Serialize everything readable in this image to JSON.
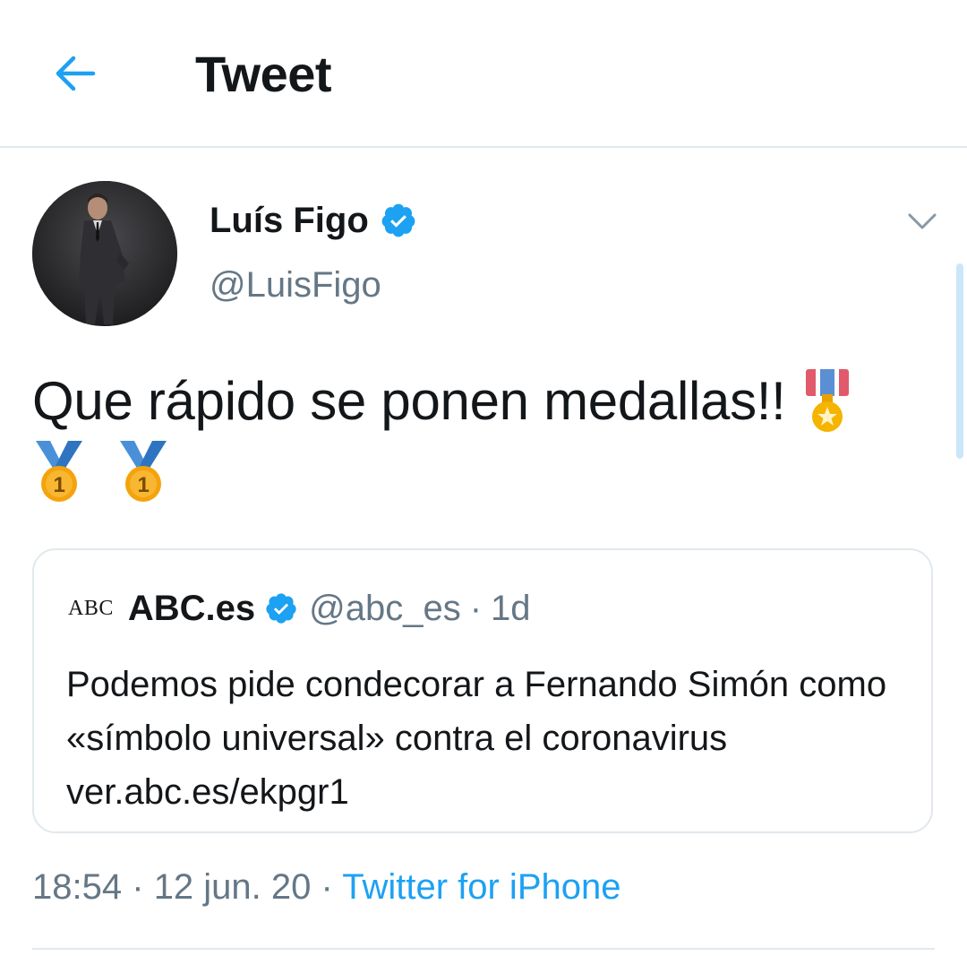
{
  "header": {
    "title": "Tweet",
    "back_icon": "arrow-left-icon",
    "accent": "#1da1f2"
  },
  "tweet": {
    "author_name": "Luís Figo",
    "author_handle": "@LuisFigo",
    "verified": true,
    "text": "Que rápido se ponen medallas!!",
    "emojis": [
      "military-medal-icon",
      "first-place-medal-icon",
      "first-place-medal-icon"
    ],
    "time": "18:54",
    "date": "12 jun. 20",
    "source": "Twitter for iPhone",
    "separator": "·"
  },
  "quote": {
    "logo_text": "ABC",
    "name": "ABC.es",
    "handle": "@abc_es",
    "separator": "·",
    "age": "1d",
    "text": "Podemos pide condecorar a Fernando Simón como «símbolo universal» contra el coronavirus ver.abc.es/ekpgr1"
  }
}
